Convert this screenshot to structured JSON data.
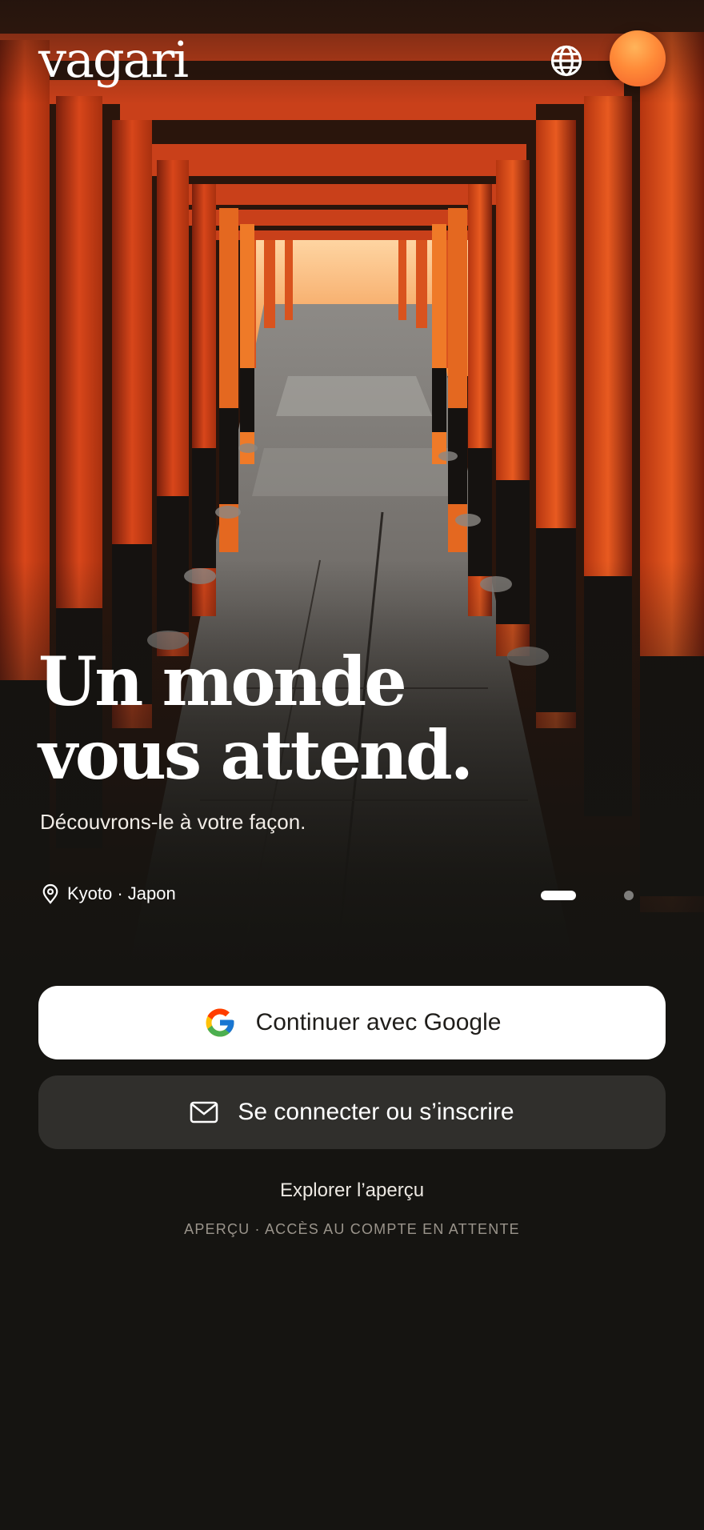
{
  "app": {
    "logo_text": "vagari"
  },
  "header": {
    "globe_icon": "globe-icon",
    "avatar_color": "#ff8a38"
  },
  "hero": {
    "headline_line1": "Un monde",
    "headline_line2": "vous attend.",
    "subtitle": "Découvrons-le à votre façon.",
    "location_icon": "map-pin-icon",
    "location": "Kyoto · Japon",
    "carousel": {
      "slide_count": 2,
      "active_index": 0
    }
  },
  "auth": {
    "google_label": "Continuer avec Google",
    "google_icon": "google-icon",
    "email_label": "Se connecter ou s’inscrire",
    "email_icon": "mail-icon",
    "explore_label": "Explorer l’aperçu",
    "status_note": "APERÇU · ACCÈS AU COMPTE EN ATTENTE"
  },
  "colors": {
    "background": "#151411",
    "primary_button": "#ffffff",
    "secondary_button": "#302f2c",
    "accent": "#ff8a38",
    "torii_red": "#e2481c"
  }
}
